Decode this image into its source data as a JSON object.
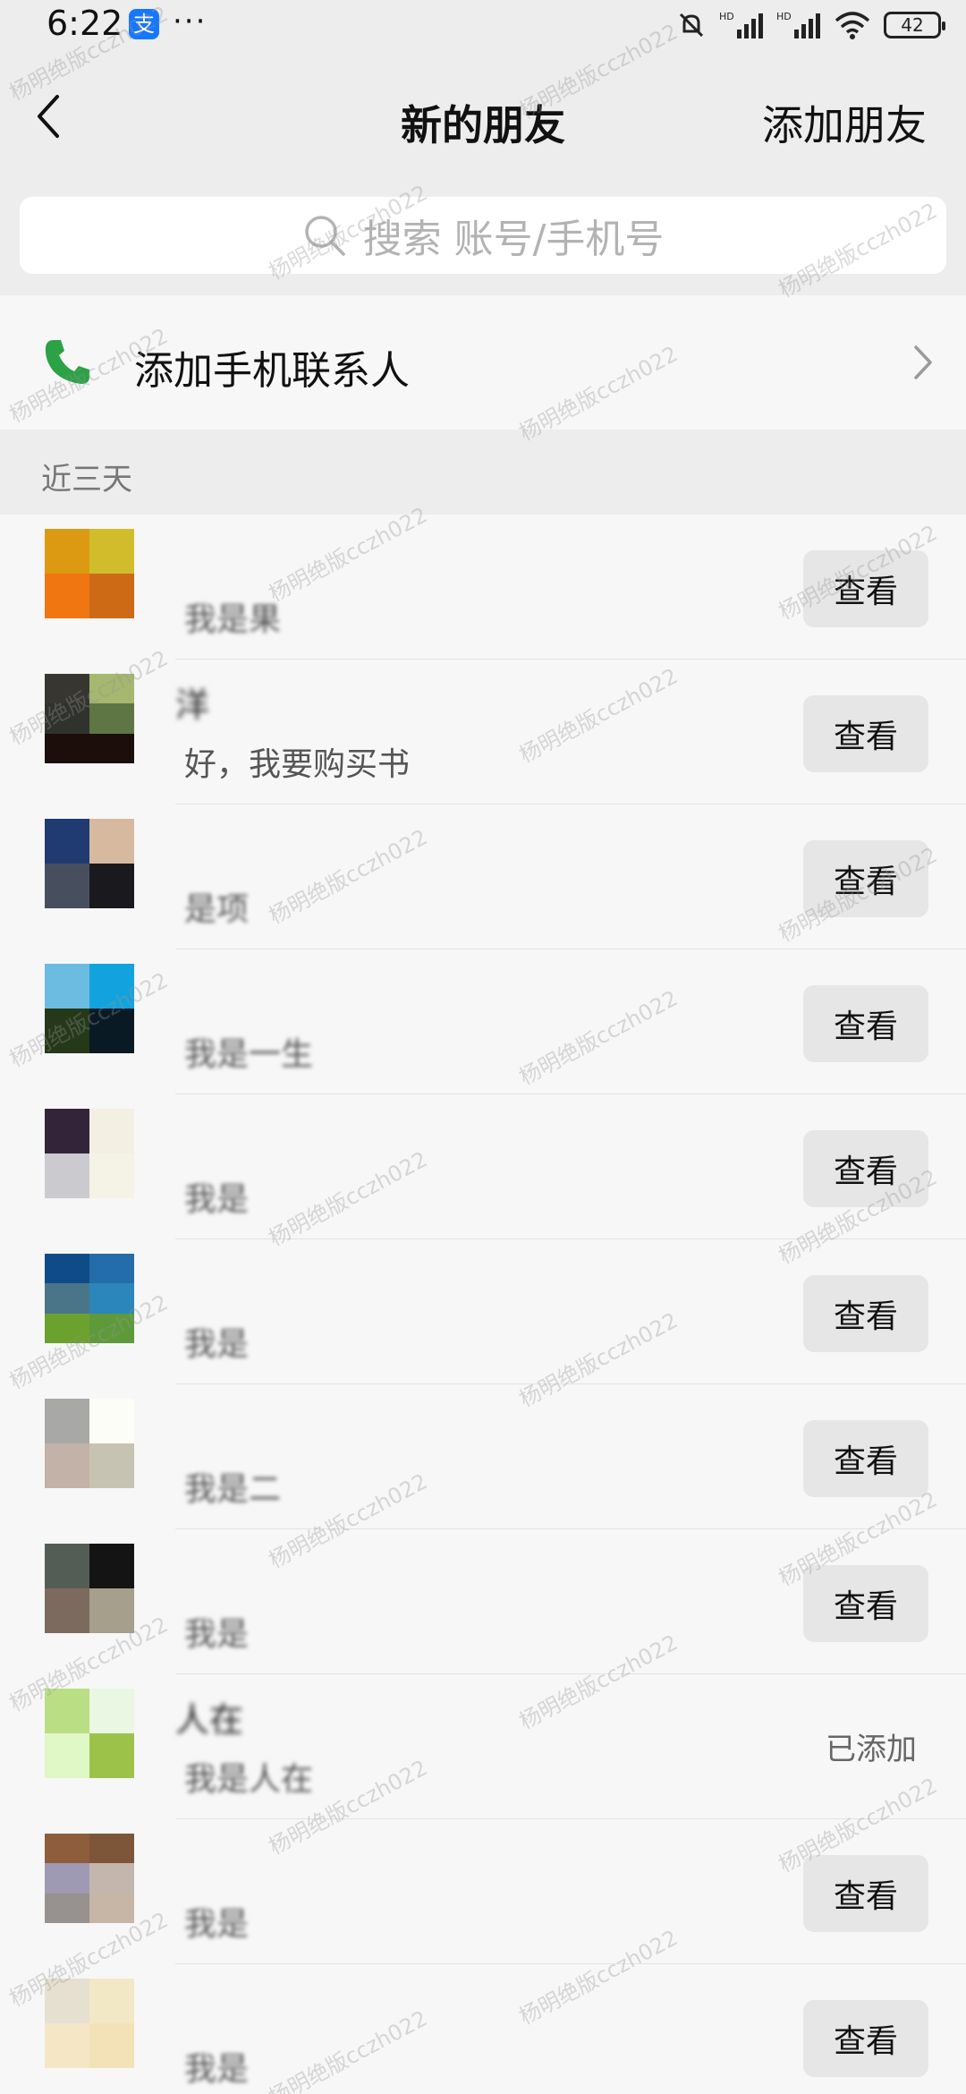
{
  "status_bar": {
    "time": "6:22",
    "dots": "···",
    "battery": "42",
    "alipay_glyph": "支"
  },
  "header": {
    "title": "新的朋友",
    "add_friend": "添加朋友"
  },
  "search": {
    "placeholder": "搜索 账号/手机号"
  },
  "add_contacts": {
    "label": "添加手机联系人"
  },
  "section": {
    "title": "近三天"
  },
  "rows": [
    {
      "name": "",
      "message": "我是果",
      "action": "查看",
      "avatar": [
        "#dc9a12",
        "#d1bd2b",
        "#ef7611",
        "#cc6a16"
      ]
    },
    {
      "name": "洋",
      "message": "好，我要购买书",
      "action": "查看",
      "avatar": [
        "#383631",
        "#a6b76f",
        "#30332d",
        "#5e7544",
        "#1c0e0a",
        "#1c0e0a"
      ]
    },
    {
      "name": "",
      "message": "是项",
      "action": "查看",
      "avatar": [
        "#203a72",
        "#d7b9a0",
        "#474f5f",
        "#1a1a1e"
      ]
    },
    {
      "name": "",
      "message": "我是一生",
      "action": "查看",
      "avatar": [
        "#6cbbe0",
        "#12a3de",
        "#253919",
        "#0a1a25"
      ]
    },
    {
      "name": "",
      "message": "我是",
      "action": "查看",
      "avatar": [
        "#34243a",
        "#f3f0e3",
        "#cbcbcf",
        "#f5f2e6"
      ]
    },
    {
      "name": "",
      "message": "我是",
      "action": "查看",
      "avatar": [
        "#0f4c87",
        "#226daa",
        "#4a7589",
        "#2b86bb",
        "#6aa22d",
        "#5e9a3a"
      ]
    },
    {
      "name": "",
      "message": "我是二",
      "action": "查看",
      "avatar": [
        "#a8a8a6",
        "#fdfdf7",
        "#c3b2a8",
        "#c6c3b2"
      ]
    },
    {
      "name": "",
      "message": "我是",
      "action": "查看",
      "avatar": [
        "#545d55",
        "#131413",
        "#7d6a5e",
        "#a59f8b"
      ]
    },
    {
      "name": "人在",
      "message": "我是人在",
      "action": "已添加",
      "avatar": [
        "#b9de84",
        "#eaf7e3",
        "#e0f7c6",
        "#9cc24a"
      ]
    },
    {
      "name": "",
      "message": "我是",
      "action": "查看",
      "avatar": [
        "#8e5d3c",
        "#7d5639",
        "#9e9ab3",
        "#c3b6ad",
        "#97928f",
        "#c7b6a6"
      ]
    },
    {
      "name": "",
      "message": "我是",
      "action": "查看",
      "avatar": [
        "#e6e0d0",
        "#f2e8c6",
        "#f5e6c6",
        "#f3e2b7"
      ]
    }
  ],
  "watermark": "杨明绝版cczh022",
  "colors": {
    "accent_green": "#2ba245",
    "bg": "#f7f7f7",
    "header_bg": "#ededed",
    "button_bg": "#e6e6e6"
  }
}
